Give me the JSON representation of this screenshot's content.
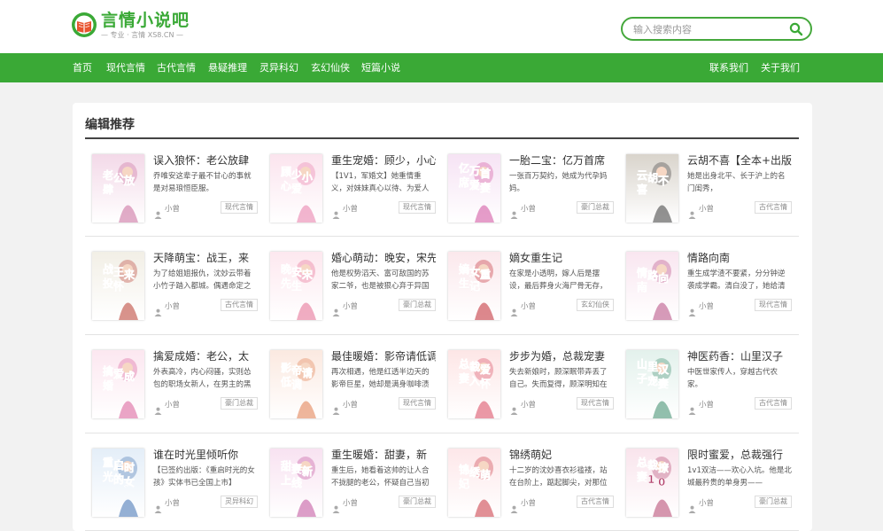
{
  "site": {
    "logo_title": "言情小说吧",
    "logo_sub": "— 专业 · 言情 XS8.CN —"
  },
  "search": {
    "placeholder": "输入搜索内容"
  },
  "nav": {
    "left": [
      "首页",
      "现代言情",
      "古代言情",
      "悬疑推理",
      "灵异科幻",
      "玄幻仙侠",
      "短篇小说"
    ],
    "right": [
      "联系我们",
      "关于我们"
    ]
  },
  "section": {
    "title": "编辑推荐"
  },
  "books": [
    {
      "title": "误入狼怀：老公放肆",
      "desc": "乔唯安这辈子最不甘心的事就是对易琅恒臣服。",
      "author": "小曾",
      "tag": "现代言情",
      "cover_text": "老公放肆",
      "cover_colors": [
        "#f3d9e8",
        "#c86a9a"
      ]
    },
    {
      "title": "重生宠婚：顾少，小心爱",
      "desc": "【1V1，军婚文】她重情重义，对妹妹真心以待、为爱人",
      "author": "小曾",
      "tag": "现代言情",
      "cover_text": "顾少小心爱",
      "cover_colors": [
        "#fbe4ee",
        "#e87aa8"
      ]
    },
    {
      "title": "一胎二宝：亿万首席",
      "desc": "一张百万契约，她成为代孕妈妈。",
      "author": "小曾",
      "tag": "豪门总裁",
      "cover_text": "亿万首席爱妻入怀",
      "cover_colors": [
        "#f6e3f4",
        "#d04c9c"
      ]
    },
    {
      "title": "云胡不喜【全本+出版】",
      "desc": "她是出身北平、长于沪上的名门闺秀，",
      "author": "小曾",
      "tag": "古代言情",
      "cover_text": "云胡不喜",
      "cover_colors": [
        "#d9d4cc",
        "#3b3a3a"
      ]
    },
    {
      "title": "天降萌宝：战王，来",
      "desc": "为了给姐姐报仇，沈妙云带着小竹子踏入都城。偶遇命定之",
      "author": "小曾",
      "tag": "古代言情",
      "cover_text": "战王来投怀",
      "cover_colors": [
        "#f2efe6",
        "#b83a2e"
      ]
    },
    {
      "title": "婚心萌动：晚安，宋先生",
      "desc": "他是权势滔天、富可敌国的苏家二爷，也是被狠心弃于异国",
      "author": "小曾",
      "tag": "豪门总裁",
      "cover_text": "晚安宋先生",
      "cover_colors": [
        "#fde8ef",
        "#e46a90"
      ]
    },
    {
      "title": "嫡女重生记",
      "desc": "在家是小透明，嫁人后是摆设，最后葬身火海尸骨无存，",
      "author": "小曾",
      "tag": "玄幻仙侠",
      "cover_text": "嫡女重生记",
      "cover_colors": [
        "#fbe8ec",
        "#c0262f"
      ]
    },
    {
      "title": "情路向南",
      "desc": "重生成学渣不要紧，分分钟逆袭成学霸。清白没了，她给清",
      "author": "小曾",
      "tag": "现代言情",
      "cover_text": "情路向南",
      "cover_colors": [
        "#f9e6f0",
        "#b54880"
      ]
    },
    {
      "title": "擒爱成婚：老公，太",
      "desc": "外表高冷，内心闷骚，实则怂包的职场女新人，在男主的黑",
      "author": "小曾",
      "tag": "豪门总裁",
      "cover_text": "擒爱成婚",
      "cover_colors": [
        "#fce7f0",
        "#d85b98"
      ]
    },
    {
      "title": "最佳暖婚：影帝请低调",
      "desc": "再次相遇，他是红透半边天的影帝巨星，她却是满身咖啡渍",
      "author": "小曾",
      "tag": "现代言情",
      "cover_text": "影帝请低调",
      "cover_colors": [
        "#fbe9e0",
        "#e07a4a"
      ]
    },
    {
      "title": "步步为婚，总裁宠妻",
      "desc": "失去新娘时，顾深眠带弄丢了自己。失而复得，顾深明知在",
      "author": "小曾",
      "tag": "现代言情",
      "cover_text": "总裁爱妻入怀",
      "cover_colors": [
        "#fde6e6",
        "#d8455c"
      ]
    },
    {
      "title": "神医药香：山里汉子",
      "desc": "中医世家传人，穿越古代农家。",
      "author": "小曾",
      "tag": "古代言情",
      "cover_text": "山里汉子宠妻",
      "cover_colors": [
        "#e3f1ec",
        "#3a8a6a"
      ]
    },
    {
      "title": "谁在时光里倾听你",
      "desc": "【已签约出版：《重启时光的女孩》实体书已全国上市】",
      "author": "小曾",
      "tag": "灵异科幻",
      "cover_text": "重启时光的女孩",
      "cover_colors": [
        "#e4eef8",
        "#3e6fb0"
      ]
    },
    {
      "title": "重生暖婚：甜妻，新",
      "desc": "重生后，她看着这帅的让人合不拢腿的老公，怀疑自己当初",
      "author": "小曾",
      "tag": "豪门总裁",
      "cover_text": "甜妻新上线",
      "cover_colors": [
        "#f8e2f1",
        "#c04e9a"
      ]
    },
    {
      "title": "锦绣萌妃",
      "desc": "十二岁的沈妙喜衣衫褴褛，站在台阶上，踮起脚尖，对那位",
      "author": "小曾",
      "tag": "古代言情",
      "cover_text": "锦绣萌妃",
      "cover_colors": [
        "#fde7e9",
        "#c8343f"
      ]
    },
    {
      "title": "限时蜜爱，总裁强行",
      "desc": "1v1双洁——欢心入坑。他是北城最矜贵的单身男——",
      "author": "小曾",
      "tag": "豪门总裁",
      "cover_text": "总裁撩妻100天",
      "cover_colors": [
        "#f9e4ec",
        "#b3416c"
      ]
    }
  ]
}
